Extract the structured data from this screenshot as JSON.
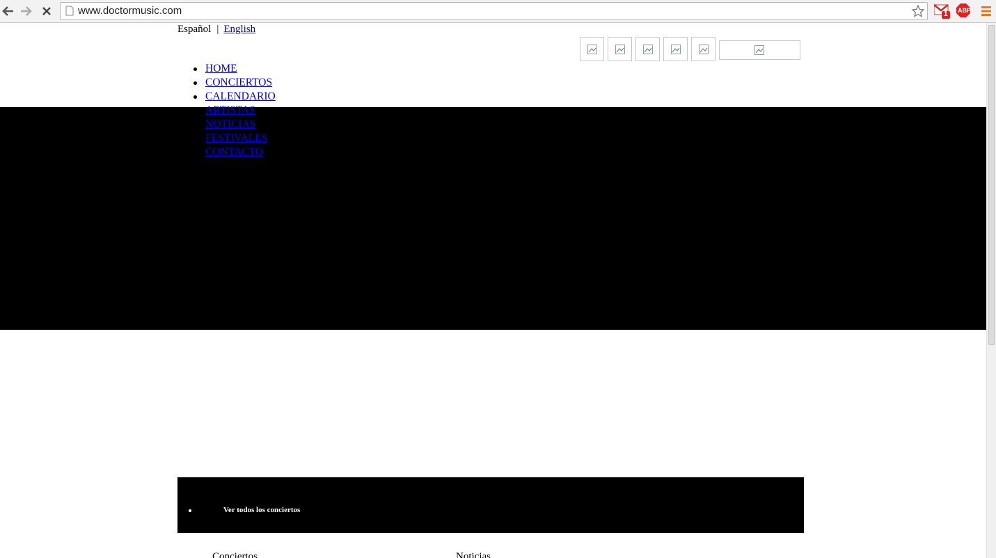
{
  "browser": {
    "url": "www.doctormusic.com",
    "gmail_badge": "1",
    "abp_label": "ABP"
  },
  "header": {
    "lang_current": "Español",
    "lang_separator": "|",
    "lang_other": "English",
    "social_icons": [
      "broken-image-icon",
      "broken-image-icon",
      "broken-image-icon",
      "broken-image-icon",
      "broken-image-icon"
    ]
  },
  "menu": {
    "items": [
      "HOME",
      "CONCIERTOS",
      "CALENDARIO",
      "ARTISTAS",
      "NOTICIAS",
      "FESTIVALES",
      "CONTACTO"
    ]
  },
  "concerts_bar": {
    "link": "Ver todos los conciertos"
  },
  "sections": {
    "conciertos": "Conciertos",
    "noticias": "Noticias"
  },
  "colors": {
    "link": "#0000ee",
    "banner": "#000000"
  }
}
